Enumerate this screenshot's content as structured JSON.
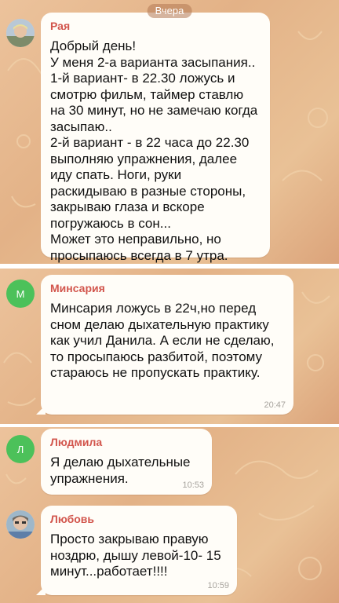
{
  "date_separator": "Вчера",
  "messages": [
    {
      "sender": "Рая",
      "avatar": {
        "type": "photo",
        "letter": ""
      },
      "text": "Добрый день!\nУ меня 2-а варианта засыпания..\n1-й вариант- в 22.30 ложусь и смотрю фильм, таймер ставлю на 30 минут, но не замечаю когда засыпаю..\n2-й вариант - в 22 часа до 22.30 выполняю упражнения, далее иду спать. Ноги, руки раскидываю в разные стороны, закрываю глаза и вскоре погружаюсь в сон...\nМожет это неправильно, но просыпаюсь всегда в 7 утра.",
      "time": ""
    },
    {
      "sender": "Минсария",
      "avatar": {
        "type": "letter",
        "letter": "М",
        "color": "#4cc15a"
      },
      "text": "Минсария ложусь в 22ч,но перед сном делаю дыхательную практику как учил Данила. А если не сделаю, то просыпаюсь разбитой, поэтому стараюсь не пропускать практику.",
      "time": "20:47"
    },
    {
      "sender": "Людмила",
      "avatar": {
        "type": "letter",
        "letter": "Л",
        "color": "#4cc15a"
      },
      "text": "Я делаю дыхательные упражнения.",
      "time": "10:53"
    },
    {
      "sender": "Любовь",
      "avatar": {
        "type": "photo",
        "letter": ""
      },
      "text": "Просто закрываю правую ноздрю, дышу левой-10- 15 минут...работает!!!!",
      "time": "10:59"
    }
  ],
  "colors": {
    "sender_name": "#d2554c",
    "bubble": "#fffdf8",
    "chat_background": "#e8b98f",
    "letter_avatar": "#4cc15a"
  }
}
